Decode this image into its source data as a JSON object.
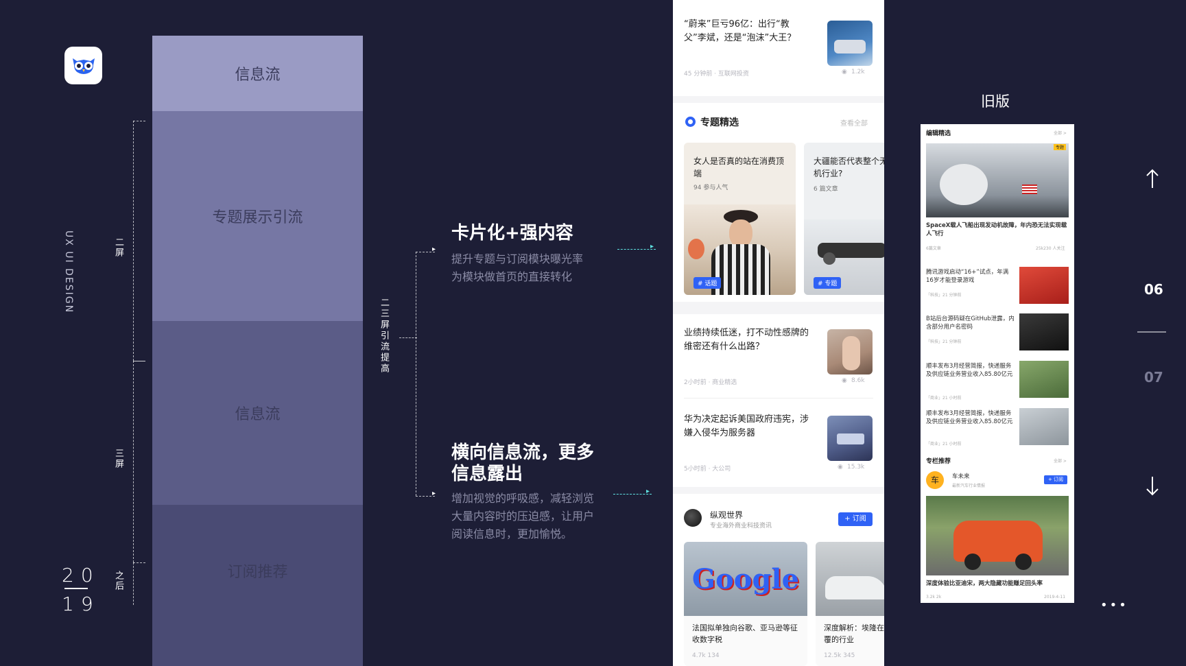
{
  "left": {
    "brand_vertical": "UX UI DESIGN",
    "year_top": "20",
    "year_bottom": "19",
    "bracket1_label": "二屏",
    "bracket2_label": "三屏",
    "bracket3_label": "之后"
  },
  "column": {
    "blocks": [
      "信息流",
      "专题展示引流",
      "信息流",
      "订阅推荐"
    ]
  },
  "annotation": {
    "group_label": "二三屏引流提高",
    "item1_title": "卡片化+强内容",
    "item1_desc_line1": "提升专题与订阅模块曝光率",
    "item1_desc_line2": "为模块做首页的直接转化",
    "item2_title_line1": "横向信息流，更多",
    "item2_title_line2": "信息露出",
    "item2_desc_line1": "增加视觉的呼吸感，减轻浏览",
    "item2_desc_line2": "大量内容时的压迫感，让用户",
    "item2_desc_line3": "阅读信息时，更加愉悦。"
  },
  "phone": {
    "news1_title": "“蔚来”巨亏96亿：出行“教父”李斌，还是“泡沫”大王？",
    "news1_meta": "45 分钟前 · 互联网投资",
    "news1_views": "1.2k",
    "topic_header": "专题精选",
    "topic_more": "查看全部",
    "topic_cards": [
      {
        "title": "女人是否真的站在消费顶端",
        "sub": "94 参与人气",
        "tag": "# 话题"
      },
      {
        "title": "大疆能否代表整个无人机行业?",
        "sub": "6 篇文章",
        "tag": "# 专题"
      }
    ],
    "news2_title": "业绩持续低迷，打不动性感牌的维密还有什么出路？",
    "news2_meta": "2小时前 · 商业精选",
    "news2_views": "8.6k",
    "news3_title": "华为决定起诉美国政府违宪，涉嫌入侵华为服务器",
    "news3_meta": "5小时前 · 大公司",
    "news3_views": "15.3k",
    "sub_name": "纵观世界",
    "sub_desc": "专业海外商业科技资讯",
    "sub_button": "+ 订阅",
    "h_cards": [
      {
        "img_text": "Google",
        "title": "法国拟单独向谷歌、亚马逊等征收数字税",
        "meta": "4.7k   134"
      },
      {
        "img_text": "",
        "title": "深度解析：埃隆在颠覆的行业",
        "meta": "12.5k  345"
      }
    ]
  },
  "old": {
    "heading": "旧版",
    "section1": "编辑精选",
    "section1_more": "全部 >",
    "hero_badge": "专题",
    "hero_title": "SpaceX载人飞船出现发动机故障，年内恐无法实现载人飞行",
    "hero_meta_left": "6篇文章",
    "hero_meta_right": "25k230 人关注",
    "items": [
      {
        "title": "腾讯游戏启动“16+”试点，年满16岁才能登录游戏",
        "meta": "「科技」21 分钟前"
      },
      {
        "title": "B站后台源码疑在GitHub泄露，内含部分用户名密码",
        "meta": "「科技」21 分钟前"
      },
      {
        "title": "顺丰发布3月经营简报，快递服务及供应链业务营业收入85.80亿元",
        "meta": "「商业」21 小时前"
      },
      {
        "title": "顺丰发布3月经营简报，快递服务及供应链业务营业收入85.80亿元",
        "meta": "「商业」21 小时前"
      }
    ],
    "section2": "专栏推荐",
    "section2_more": "全部 >",
    "col_name": "车未来",
    "col_desc": "最新汽车行业情报",
    "col_button": "+ 订阅",
    "car_title": "深度体验比亚迪宋，两大隐藏功能赚足回头率",
    "car_meta_left": "3.2k  2k",
    "car_meta_right": "2019-4-11"
  },
  "nav": {
    "page_current": "06",
    "page_next": "07",
    "more": "•••"
  },
  "colors": {
    "bg": "#1d1e36",
    "block1": "#9a9bc4",
    "block2": "#7677a4",
    "block3": "#5b5c87",
    "block4": "#4a4b74",
    "accent_blue": "#2f62f5",
    "cyan": "#5ee0e0"
  }
}
